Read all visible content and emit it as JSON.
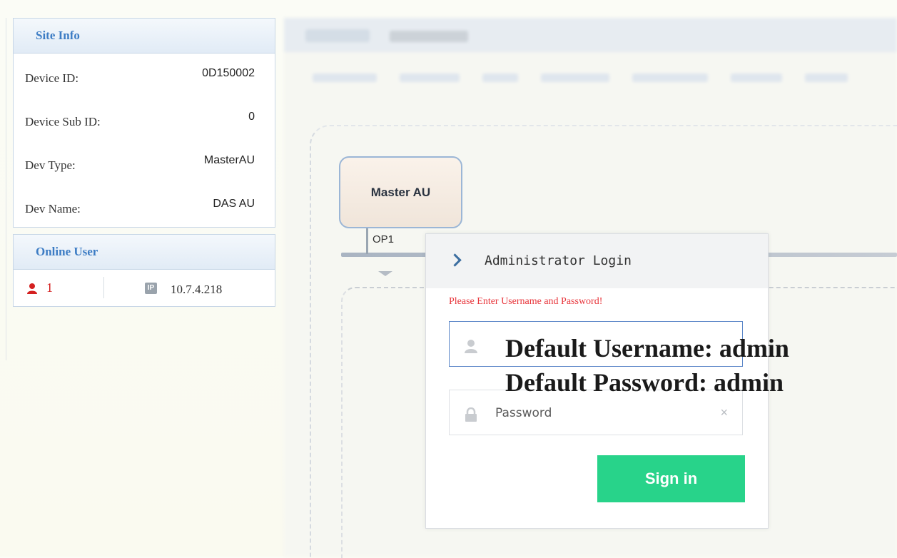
{
  "site_info": {
    "title": "Site Info",
    "rows": [
      {
        "label": "Device ID:",
        "value": "0D150002"
      },
      {
        "label": "Device Sub ID:",
        "value": "0"
      },
      {
        "label": "Dev Type:",
        "value": "MasterAU"
      },
      {
        "label": "Dev Name:",
        "value": "DAS AU"
      }
    ]
  },
  "online_user": {
    "title": "Online User",
    "count": "1",
    "ip_badge": "IP",
    "ip": "10.7.4.218"
  },
  "topology": {
    "master_node": "Master AU",
    "port_label": "OP1"
  },
  "login": {
    "title": "Administrator Login",
    "message": "Please Enter Username and Password!",
    "username_placeholder": "",
    "password_placeholder": "Password",
    "clear_icon": "×",
    "signin_label": "Sign in"
  },
  "overlay_note": {
    "line1": "Default Username: admin",
    "line2": "Default Password: admin"
  },
  "colors": {
    "panel_header_text": "#3c7cc4",
    "error_text": "#e8353b",
    "signin_bg": "#28d38a",
    "user_icon": "#d42020"
  }
}
